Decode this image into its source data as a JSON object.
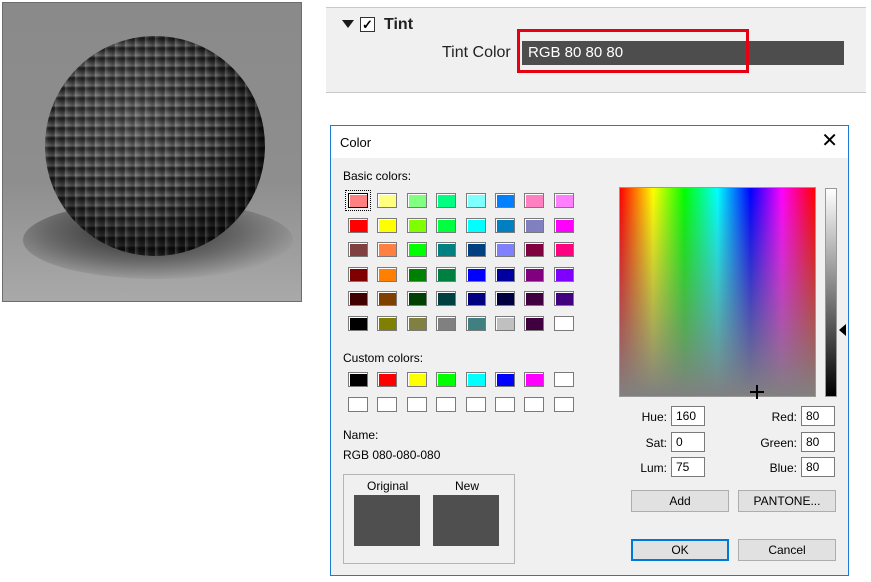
{
  "tint_panel": {
    "section_title": "Tint",
    "checkbox_checked": true,
    "color_label": "Tint Color",
    "color_value": "RGB 80 80 80"
  },
  "dialog": {
    "title": "Color",
    "close_glyph": "✕",
    "basic_colors_label": "Basic colors:",
    "custom_colors_label": "Custom colors:",
    "basic_colors": [
      "#ff8080",
      "#ffff80",
      "#80ff80",
      "#00ff80",
      "#80ffff",
      "#0080ff",
      "#ff80c0",
      "#ff80ff",
      "#ff0000",
      "#ffff00",
      "#80ff00",
      "#00ff40",
      "#00ffff",
      "#0080c0",
      "#8080c0",
      "#ff00ff",
      "#804040",
      "#ff8040",
      "#00ff00",
      "#008080",
      "#004080",
      "#8080ff",
      "#800040",
      "#ff0080",
      "#800000",
      "#ff8000",
      "#008000",
      "#008040",
      "#0000ff",
      "#0000a0",
      "#800080",
      "#8000ff",
      "#400000",
      "#804000",
      "#004000",
      "#004040",
      "#000080",
      "#000040",
      "#400040",
      "#400080",
      "#000000",
      "#808000",
      "#808040",
      "#808080",
      "#408080",
      "#c0c0c0",
      "#400040",
      "#ffffff"
    ],
    "custom_colors": [
      "#000000",
      "#ff0000",
      "#ffff00",
      "#00ff00",
      "#00ffff",
      "#0000ff",
      "#ff00ff",
      "#ffffff",
      "#ffffff",
      "#ffffff",
      "#ffffff",
      "#ffffff",
      "#ffffff",
      "#ffffff",
      "#ffffff",
      "#ffffff"
    ],
    "name_label": "Name:",
    "name_value": "RGB 080-080-080",
    "original_label": "Original",
    "new_label": "New",
    "original_color": "#4f4f4f",
    "new_color": "#4f4f4f",
    "hue_label": "Hue:",
    "hue_value": "160",
    "sat_label": "Sat:",
    "sat_value": "0",
    "lum_label": "Lum:",
    "lum_value": "75",
    "red_label": "Red:",
    "red_value": "80",
    "green_label": "Green:",
    "green_value": "80",
    "blue_label": "Blue:",
    "blue_value": "80",
    "add_button": "Add",
    "pantone_button": "PANTONE...",
    "ok_button": "OK",
    "cancel_button": "Cancel"
  },
  "colors": {
    "highlight_border": "#e60012",
    "dialog_border": "#1f7bd1",
    "ok_focus": "#0078d7"
  }
}
